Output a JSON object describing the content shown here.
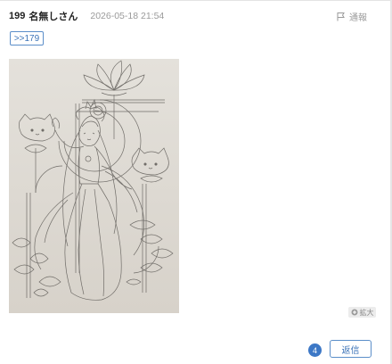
{
  "post": {
    "number": "199",
    "name": "名無しさん",
    "date": "2026-05-18 21:54",
    "report_label": "通報",
    "anchor_label": ">>179",
    "image_icon": "lotus-goddess-sketch",
    "zoom_label": "拡大",
    "reply_count": "4",
    "reply_label": "返信"
  },
  "colors": {
    "accent": "#3d74b8",
    "badge": "#3d78c6",
    "muted": "#9a9a9a",
    "image_bg": "#dfdbd4"
  }
}
